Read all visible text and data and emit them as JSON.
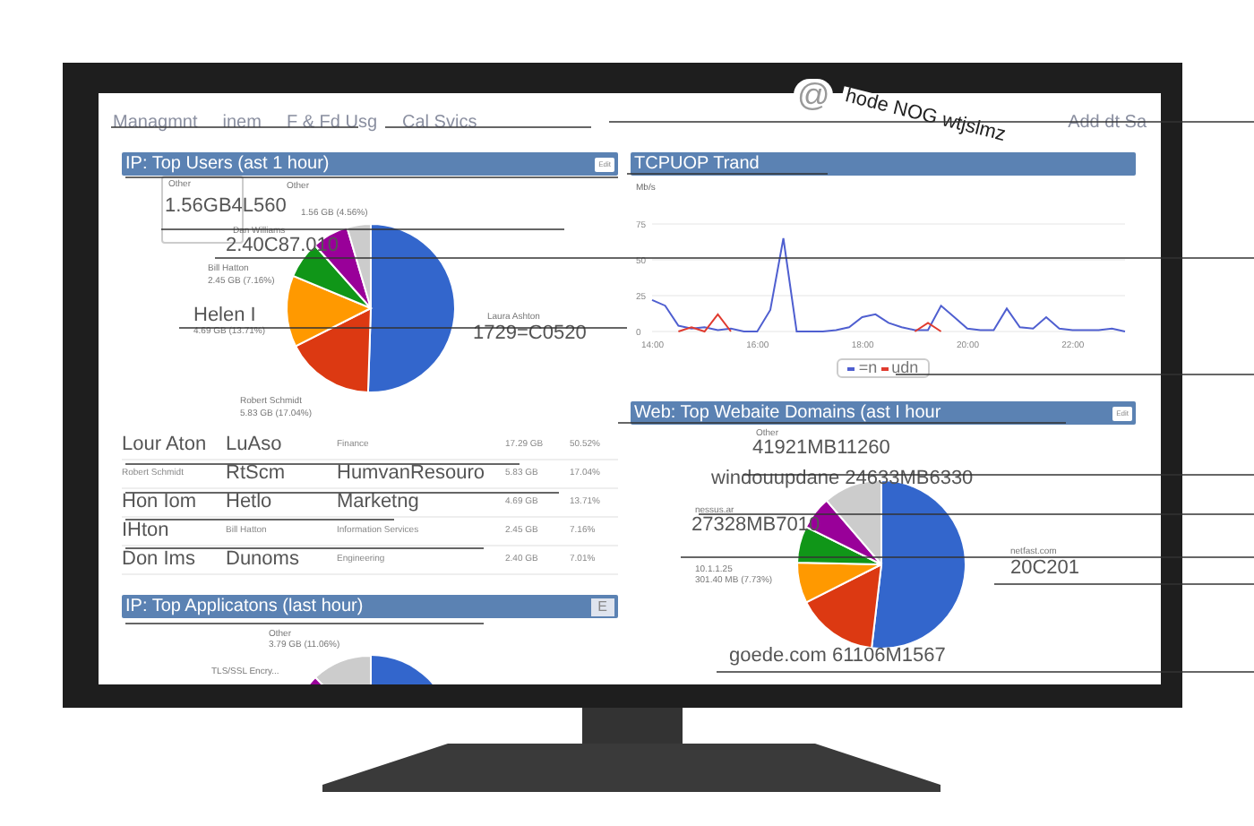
{
  "nav": {
    "links": [
      "Managmnt",
      "inem",
      "F & Fd Usg",
      "Cal Svics"
    ],
    "at_sign": "@",
    "annotation": "hode NOG wtjslmz",
    "right_link": "Add dt Sa"
  },
  "top_users": {
    "title": "IP: Top Users (ast 1 hour)",
    "edit": "Edit",
    "labels": [
      {
        "text": "Other",
        "kind": "small"
      },
      {
        "text": "1.56GB4L560",
        "kind": "large"
      },
      {
        "text": "Other",
        "kind": "small"
      },
      {
        "text": "1.56 GB (4.56%)",
        "kind": "small"
      },
      {
        "text": "Dan Williams",
        "kind": "small"
      },
      {
        "text": "2.40C87.010",
        "kind": "large"
      },
      {
        "text": "Bill Hatton",
        "kind": "small"
      },
      {
        "text": "2.45 GB (7.16%)",
        "kind": "small"
      },
      {
        "text": "Helen I",
        "kind": "large"
      },
      {
        "text": "4.69 GB (13.71%)",
        "kind": "small"
      },
      {
        "text": "Laura Ashton",
        "kind": "small"
      },
      {
        "text": "1729=C0520",
        "kind": "large"
      },
      {
        "text": "Robert Schmidt",
        "kind": "small"
      },
      {
        "text": "5.83 GB (17.04%)",
        "kind": "small"
      }
    ],
    "table": {
      "rows": [
        [
          {
            "text": "Lour Aton",
            "kind": "large"
          },
          {
            "text": "LuAso",
            "kind": "large"
          },
          {
            "text": "Finance",
            "kind": "small"
          },
          {
            "text": "17.29 GB",
            "kind": "small"
          },
          {
            "text": "50.52%",
            "kind": "small"
          }
        ],
        [
          {
            "text": "Robert Schmidt",
            "kind": "small"
          },
          {
            "text": "RtScm",
            "kind": "large"
          },
          {
            "text": "HumvanResouro",
            "kind": "large"
          },
          {
            "text": "5.83 GB",
            "kind": "small"
          },
          {
            "text": "17.04%",
            "kind": "small"
          }
        ],
        [
          {
            "text": "Hon Iom",
            "kind": "large"
          },
          {
            "text": "Hetlo",
            "kind": "large"
          },
          {
            "text": "Marketng",
            "kind": "large"
          },
          {
            "text": "4.69 GB",
            "kind": "small"
          },
          {
            "text": "13.71%",
            "kind": "small"
          }
        ],
        [
          {
            "text": "IHton",
            "kind": "large"
          },
          {
            "text": "Bill Hatton",
            "kind": "small"
          },
          {
            "text": "Information Services",
            "kind": "small"
          },
          {
            "text": "2.45 GB",
            "kind": "small"
          },
          {
            "text": "7.16%",
            "kind": "small"
          }
        ],
        [
          {
            "text": "Don Ims",
            "kind": "large"
          },
          {
            "text": "Dunoms",
            "kind": "large"
          },
          {
            "text": "Engineering",
            "kind": "small"
          },
          {
            "text": "2.40 GB",
            "kind": "small"
          },
          {
            "text": "7.01%",
            "kind": "small"
          }
        ]
      ]
    }
  },
  "top_apps": {
    "title": "IP: Top Applicatons (last  hour)",
    "edit": "E",
    "labels": [
      {
        "text": "Other",
        "kind": "small"
      },
      {
        "text": "3.79 GB (11.06%)",
        "kind": "small"
      },
      {
        "text": "TLS/SSL Encry...",
        "kind": "small"
      }
    ]
  },
  "trend": {
    "title": "TCPUOP Trand",
    "chart_data": {
      "type": "line",
      "ylabel": "Mb/s",
      "grid": true,
      "x": [
        14,
        14.25,
        14.5,
        14.75,
        15,
        15.25,
        15.5,
        15.75,
        16,
        16.25,
        16.5,
        16.75,
        17,
        17.25,
        17.5,
        17.75,
        18,
        18.25,
        18.5,
        18.75,
        19,
        19.25,
        19.5,
        19.75,
        20,
        20.25,
        20.5,
        20.75,
        21,
        21.25,
        21.5,
        21.75,
        22,
        22.25,
        22.5,
        22.75,
        23
      ],
      "xlim": [
        14,
        23
      ],
      "ylim": [
        0,
        75
      ],
      "xticks": [
        {
          "value": 14,
          "label": "14:00"
        },
        {
          "value": 16,
          "label": "16:00"
        },
        {
          "value": 18,
          "label": "18:00"
        },
        {
          "value": 20,
          "label": "20:00"
        },
        {
          "value": 22,
          "label": "22:00"
        }
      ],
      "yticks": [
        0,
        25,
        50,
        75
      ],
      "series": [
        {
          "name": "=n",
          "color": "#4f5fd0",
          "values": [
            22,
            18,
            4,
            2,
            3,
            1,
            2,
            0,
            0,
            15,
            65,
            0,
            0,
            0,
            1,
            3,
            10,
            12,
            6,
            3,
            1,
            1,
            18,
            10,
            2,
            1,
            1,
            16,
            3,
            2,
            10,
            2,
            1,
            1,
            1,
            2,
            0
          ]
        },
        {
          "name": "udn",
          "color": "#e03b2f",
          "values": [
            null,
            null,
            0,
            3,
            0,
            12,
            0,
            null,
            null,
            null,
            null,
            null,
            null,
            null,
            null,
            null,
            null,
            null,
            null,
            null,
            0,
            6,
            0,
            null,
            null,
            null,
            null,
            null,
            null,
            null,
            null,
            null,
            null,
            null,
            null,
            null,
            null
          ]
        }
      ]
    }
  },
  "web": {
    "title": "Web: Top Webaite Domains (ast I hour",
    "edit": "Edit",
    "labels": [
      {
        "text": "Other",
        "kind": "small"
      },
      {
        "text": "41921MB11260",
        "kind": "large"
      },
      {
        "text": "windouupdane 24633MB6330",
        "kind": "large"
      },
      {
        "text": "nessus.ar",
        "kind": "small"
      },
      {
        "text": "27328MB7010",
        "kind": "large"
      },
      {
        "text": "10.1.1.25",
        "kind": "small"
      },
      {
        "text": "301.40 MB (7.73%)",
        "kind": "small"
      },
      {
        "text": "netfast.com",
        "kind": "small"
      },
      {
        "text": "20C201",
        "kind": "large"
      },
      {
        "text": "goede.com 61106M1567",
        "kind": "large"
      }
    ]
  }
}
